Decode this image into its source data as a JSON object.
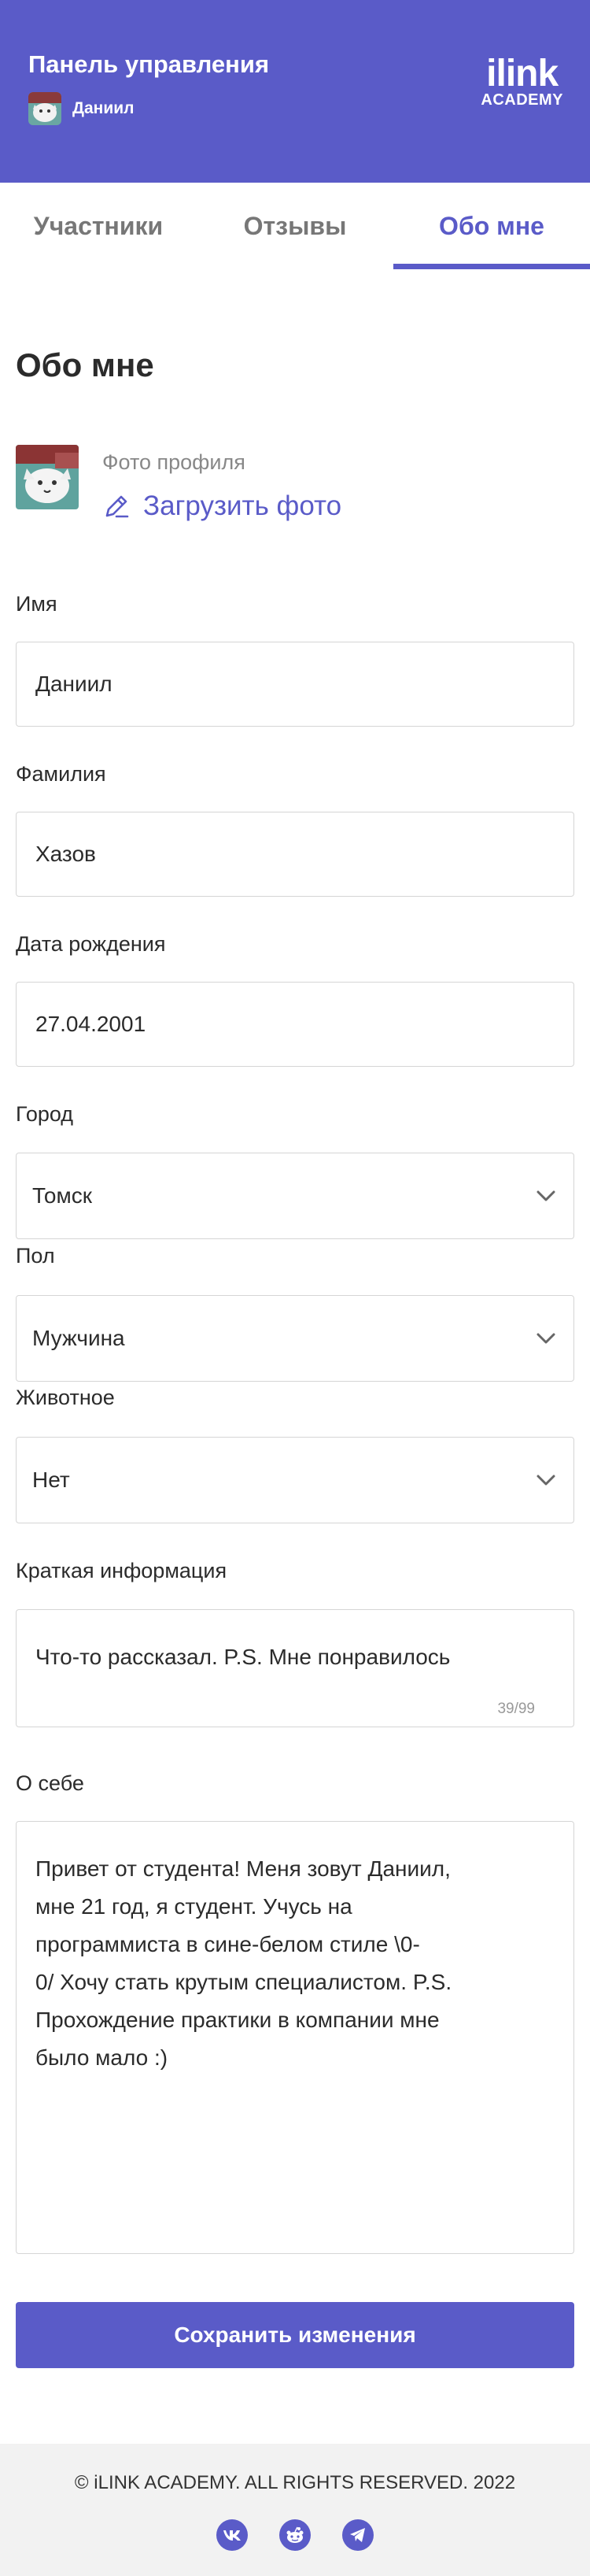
{
  "header": {
    "title": "Панель управления",
    "user_name": "Даниил",
    "logo_main": "ilink",
    "logo_sub": "ACADEMY"
  },
  "tabs": [
    {
      "label": "Участники",
      "active": false
    },
    {
      "label": "Отзывы",
      "active": false
    },
    {
      "label": "Обо мне",
      "active": true
    }
  ],
  "section_title": "Обо мне",
  "photo": {
    "label": "Фото профиля",
    "upload_label": "Загрузить фото"
  },
  "form": {
    "first_name": {
      "label": "Имя",
      "value": "Даниил"
    },
    "last_name": {
      "label": "Фамилия",
      "value": "Хазов"
    },
    "birth_date": {
      "label": "Дата рождения",
      "value": "27.04.2001"
    },
    "city": {
      "label": "Город",
      "value": "Томск"
    },
    "gender": {
      "label": "Пол",
      "value": "Мужчина"
    },
    "pet": {
      "label": "Животное",
      "value": "Нет"
    },
    "short_info": {
      "label": "Краткая информация",
      "value": "Что-то рассказал. P.S. Мне понравилось",
      "counter": "39/99"
    },
    "about": {
      "label": "О себе",
      "lines": [
        "Привет от студента! Меня зовут Даниил,",
        "мне 21 год, я студент. Учусь на",
        "программиста в сине-белом стиле \\0-",
        "0/  Хочу стать крутым специалистом. P.S.",
        "Прохождение практики в компании мне",
        "было мало :)"
      ]
    }
  },
  "save_label": "Сохранить изменения",
  "footer": {
    "copyright": "© iLINK ACADEMY. ALL RIGHTS RESERVED. 2022",
    "social_icons": [
      "vk-icon",
      "reddit-icon",
      "telegram-icon"
    ]
  },
  "colors": {
    "accent": "#5a5bc8",
    "footer_bg": "#f2f2f2"
  }
}
